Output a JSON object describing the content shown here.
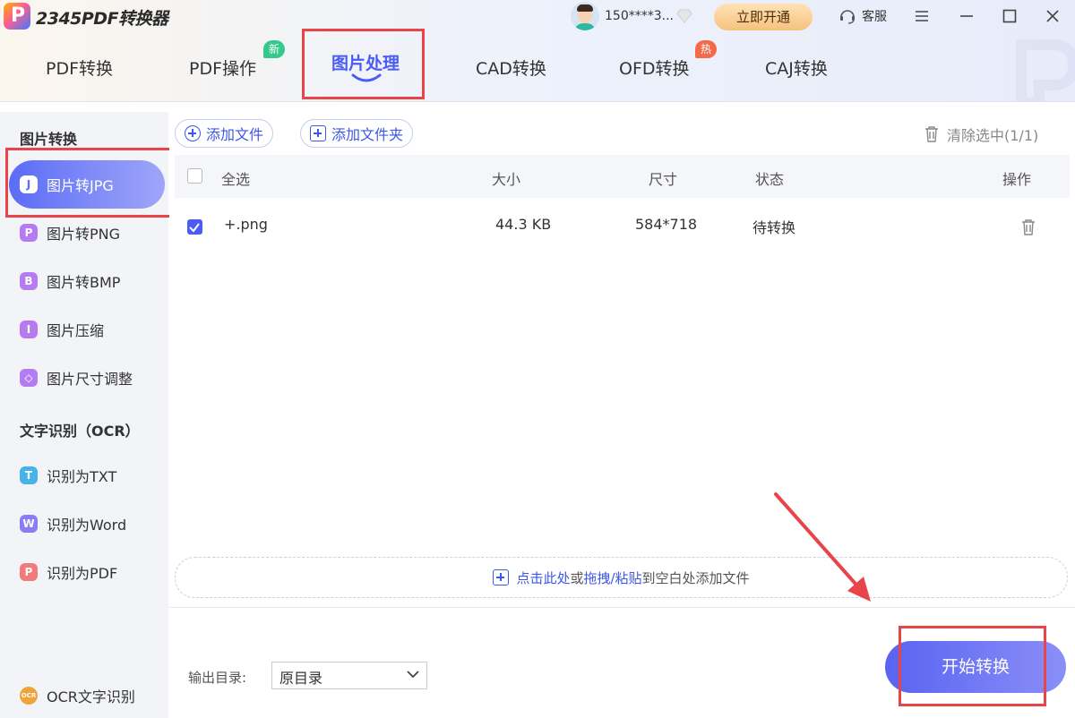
{
  "header": {
    "app_title": "2345PDF转换器",
    "user_name": "150****3...",
    "vip_button": "立即开通",
    "service": "客服"
  },
  "tabs": [
    {
      "label": "PDF转换"
    },
    {
      "label": "PDF操作",
      "badge": "新"
    },
    {
      "label": "图片处理"
    },
    {
      "label": "CAD转换"
    },
    {
      "label": "OFD转换",
      "badge": "热"
    },
    {
      "label": "CAJ转换"
    }
  ],
  "sidebar": {
    "section1": "图片转换",
    "items1": [
      {
        "label": "图片转JPG",
        "icon": "J",
        "color": "#5b6cf6"
      },
      {
        "label": "图片转PNG",
        "icon": "P",
        "color": "#b57cf2"
      },
      {
        "label": "图片转BMP",
        "icon": "B",
        "color": "#b57cf2"
      },
      {
        "label": "图片压缩",
        "icon": "I",
        "color": "#b57cf2"
      },
      {
        "label": "图片尺寸调整",
        "icon": "◇",
        "color": "#b57cf2"
      }
    ],
    "section2": "文字识别（OCR）",
    "items2": [
      {
        "label": "识别为TXT",
        "icon": "T",
        "color": "#49b3e8"
      },
      {
        "label": "识别为Word",
        "icon": "W",
        "color": "#8a7cf2"
      },
      {
        "label": "识别为PDF",
        "icon": "P",
        "color": "#f27a7a"
      }
    ],
    "bottom_item": {
      "label": "OCR文字识别",
      "icon": "OCR"
    }
  },
  "toolbar": {
    "add_file": "添加文件",
    "add_folder": "添加文件夹",
    "clear_selected": "清除选中(1/1)"
  },
  "table": {
    "headers": {
      "select_all": "全选",
      "size": "大小",
      "dimension": "尺寸",
      "status": "状态",
      "action": "操作"
    },
    "rows": [
      {
        "name": "+.png",
        "size": "44.3 KB",
        "dimension": "584*718",
        "status": "待转换",
        "checked": true
      }
    ]
  },
  "dropzone": {
    "click_here": "点击此处",
    "or": "或",
    "drag_paste": "拖拽/粘贴",
    "rest": "到空白处添加文件"
  },
  "output": {
    "label": "输出目录:",
    "value": "原目录"
  },
  "start_button": "开始转换",
  "colors": {
    "accent": "#4a5cf5",
    "highlight_box": "#e8454b",
    "badge_new": "#35c98e",
    "badge_hot": "#f26a4b"
  }
}
